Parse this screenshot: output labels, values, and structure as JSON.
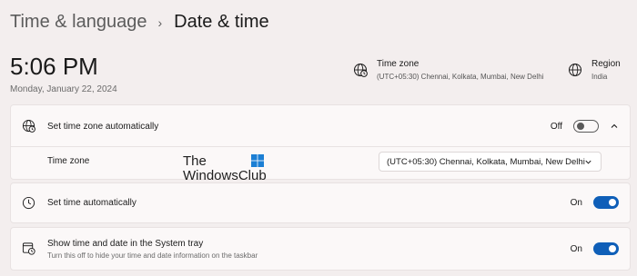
{
  "breadcrumb": {
    "parent": "Time & language",
    "separator": "›",
    "current": "Date & time"
  },
  "clock": {
    "time": "5:06 PM",
    "date": "Monday, January 22, 2024"
  },
  "header_info": {
    "timezone": {
      "title": "Time zone",
      "value": "(UTC+05:30) Chennai, Kolkata, Mumbai, New Delhi",
      "icon": "globe-clock-icon"
    },
    "region": {
      "title": "Region",
      "value": "India",
      "icon": "globe-icon"
    }
  },
  "settings": {
    "auto_timezone": {
      "label": "Set time zone automatically",
      "state": "Off",
      "on": false,
      "icon": "globe-clock-icon",
      "expanded": true
    },
    "timezone_select": {
      "label": "Time zone",
      "value": "(UTC+05:30) Chennai, Kolkata, Mumbai, New Delhi"
    },
    "auto_time": {
      "label": "Set time automatically",
      "state": "On",
      "on": true,
      "icon": "clock-icon"
    },
    "tray": {
      "label": "Show time and date in the System tray",
      "description": "Turn this off to hide your time and date information on the taskbar",
      "state": "On",
      "on": true,
      "icon": "calendar-clock-icon"
    }
  },
  "watermark": {
    "line1": "The",
    "line2": "WindowsClub"
  },
  "colors": {
    "background": "#f3eeee",
    "card": "#fbf8f8",
    "accent": "#0f5fb8"
  }
}
